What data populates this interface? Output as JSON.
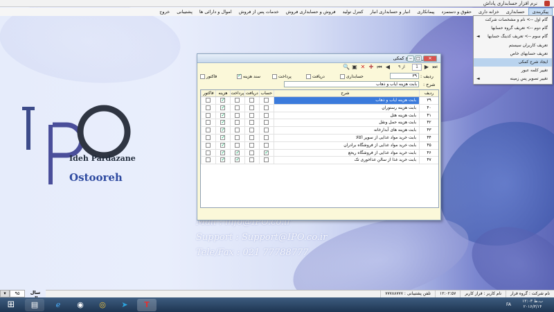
{
  "app": {
    "title": "نرم افزار حسابداری پاداش"
  },
  "menu": [
    "پیکربندی",
    "حسابداری",
    "خزانه داری",
    "حقوق و دستمزد",
    "پیمانکاری",
    "انبار و حسابداری انبار",
    "کنترل تولید",
    "فروش و حسابداری فروش",
    "خدمات پس از فروش",
    "اموال و دارائی ها",
    "پشتیبانی",
    "خروج"
  ],
  "dropdown": [
    {
      "label": "گام اول --> نام و مشخصات شرکت",
      "arrow": ""
    },
    {
      "label": "گام دوم --> تعریف گروه حسابها",
      "arrow": ""
    },
    {
      "label": "گام سوم --> تعریف کدینگ حسابها",
      "arrow": "◄"
    },
    {
      "label": "تعریف کاربران سیستم",
      "arrow": ""
    },
    {
      "label": "تعریف حسابهای خاص",
      "arrow": ""
    },
    {
      "label": "ایجاد شرح کمکی",
      "arrow": ""
    },
    {
      "label": "تغییر کلمه عبور",
      "arrow": ""
    },
    {
      "label": "تغییر تصویر پس زمینه",
      "arrow": "◄"
    }
  ],
  "logo": {
    "line1": "Ideh Pardazane",
    "line2": "Ostooreh"
  },
  "contact": [
    "Mail : info@IPO.co.ir",
    "Support : Support@IPO.co.ir",
    "Tele/Fax : 021 77788777"
  ],
  "dialog": {
    "title": "تعریف شرح کمکی",
    "nav": {
      "page": "1",
      "of": "از ۹"
    },
    "code_label": "ردیف :",
    "code_value": "۳۹",
    "desc_label": "شرح :",
    "desc_value": "بابت هزینه ایاب و ذهاب",
    "checks": [
      {
        "label": "حسابداری",
        "on": false
      },
      {
        "label": "دریافت",
        "on": false
      },
      {
        "label": "پرداخت",
        "on": false
      },
      {
        "label": "سند هزینه",
        "on": true
      },
      {
        "label": "فاکتور",
        "on": false
      }
    ],
    "columns": [
      "ردیف",
      "شرح",
      "حساب",
      "دریافت",
      "پرداخت",
      "هزینه",
      "فاکتور"
    ],
    "rows": [
      {
        "id": "۳۹",
        "desc": "بابت هزینه ایاب و ذهاب",
        "f": [
          false,
          false,
          false,
          true,
          false
        ],
        "sel": true
      },
      {
        "id": "۴۰",
        "desc": "بابت هزینه رستوران",
        "f": [
          false,
          false,
          false,
          true,
          false
        ]
      },
      {
        "id": "۴۱",
        "desc": "بابت هزینه هتل",
        "f": [
          false,
          false,
          false,
          true,
          false
        ]
      },
      {
        "id": "۴۲",
        "desc": "بابت هزینه حمل ونقل",
        "f": [
          false,
          false,
          false,
          true,
          false
        ]
      },
      {
        "id": "۴۳",
        "desc": "بابت هزینه های آبدارخانه",
        "f": [
          false,
          false,
          false,
          true,
          false
        ]
      },
      {
        "id": "۴۴",
        "desc": "بابت خرید مواد غذایی از سوپر اکالا",
        "f": [
          false,
          false,
          false,
          true,
          false
        ]
      },
      {
        "id": "۴۵",
        "desc": "بابت خرید مواد غذایی از فروشگاه برادران",
        "f": [
          false,
          false,
          false,
          true,
          false
        ]
      },
      {
        "id": "۴۶",
        "desc": "بابت خرید مواد غذایی از فروشگاه ریحع",
        "f": [
          true,
          false,
          true,
          true,
          false
        ]
      },
      {
        "id": "۴۷",
        "desc": "بابت خرید غذا از سالن غذاخوری تک",
        "f": [
          false,
          false,
          true,
          true,
          false
        ]
      }
    ]
  },
  "status": [
    "نام شرکت : گروه فرار",
    "نام کاربر : فراز کاربر",
    "۱۲:۰۲:۵۷",
    "تلفن پشتیبانی : ۷۷۷۸۸۷۷۷"
  ],
  "year": {
    "value": "۹۵",
    "label": "سال مالی"
  },
  "tray": {
    "lang": "FA",
    "time": "۱۲:۰۳ ب.ظ",
    "date": "۲۰۱۶/۳/۱۴"
  }
}
